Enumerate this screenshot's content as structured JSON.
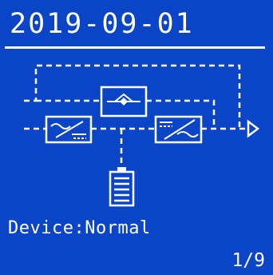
{
  "header": {
    "date": "2019-09-01"
  },
  "diagram": {
    "nodes": {
      "bypass": "bypass-icon",
      "rectifier": "rectifier-icon",
      "inverter": "inverter-icon",
      "battery": "battery-icon",
      "output": "output-arrow-icon"
    }
  },
  "status": {
    "text": "Device:Normal"
  },
  "pager": {
    "text": "1/9"
  },
  "colors": {
    "background": "#0a45c7",
    "foreground": "#ffffff"
  }
}
